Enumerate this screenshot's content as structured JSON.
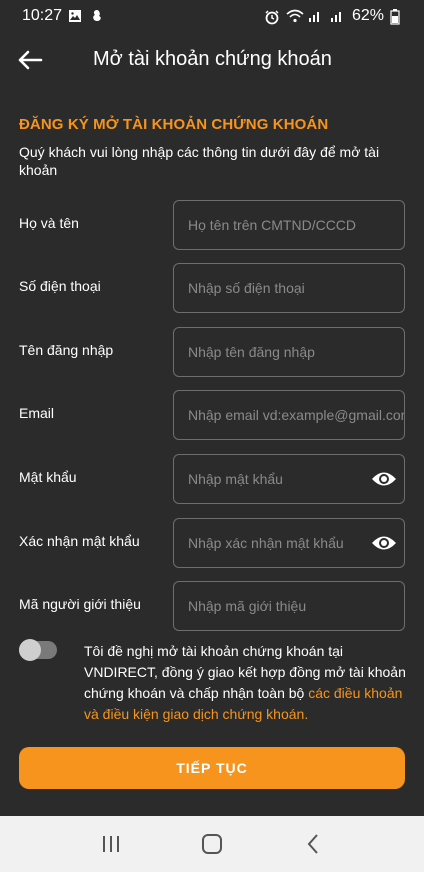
{
  "status_bar": {
    "time": "10:27",
    "battery": "62%",
    "left_icons": [
      "gallery-icon",
      "notification-icon"
    ],
    "right_icons": [
      "alarm-icon",
      "wifi-icon",
      "signal-icon",
      "signal-icon",
      "battery-icon"
    ]
  },
  "app_bar": {
    "title": "Mở tài khoản chứng khoán",
    "back_icon": "arrow-left-icon"
  },
  "section": {
    "title": "ĐĂNG KÝ MỞ TÀI KHOẢN CHỨNG KHOÁN",
    "description": "Quý khách vui lòng nhập các thông tin dưới đây để mở tài khoản"
  },
  "form": {
    "fields": [
      {
        "label": "Họ và tên",
        "placeholder": "Họ tên trên CMTND/CCCD",
        "value": ""
      },
      {
        "label": "Số điện thoại",
        "placeholder": "Nhập số điện thoại",
        "value": ""
      },
      {
        "label": "Tên đăng nhập",
        "placeholder": "Nhập tên đăng nhập",
        "value": ""
      },
      {
        "label": "Email",
        "placeholder": "Nhập email vd:example@gmail.com",
        "value": ""
      },
      {
        "label": "Mật khẩu",
        "placeholder": "Nhập mật khẩu",
        "value": "",
        "icon": "eye-icon"
      },
      {
        "label": "Xác nhận mật khẩu",
        "placeholder": "Nhập xác nhận mật khẩu",
        "value": "",
        "icon": "eye-icon"
      },
      {
        "label": "Mã người giới thiệu",
        "placeholder": "Nhập mã giới thiệu",
        "value": ""
      }
    ]
  },
  "consent": {
    "toggle_on": false,
    "text": "Tôi đề nghị mở tài khoản chứng khoán tại VNDIRECT, đồng ý giao kết hợp đồng mở tài khoản chứng khoán và chấp nhận toàn bộ ",
    "link_text": "các điều khoản và điều kiện giao dịch chứng khoán",
    "end_text": "."
  },
  "continue_button": {
    "label": "TIẾP TỤC"
  },
  "nav_bar": {
    "icons": [
      "recent-apps-icon",
      "home-icon",
      "back-icon"
    ]
  },
  "colors": {
    "background": "#2b2b2b",
    "accent": "#f7941d",
    "field_border": "#6e6e6e",
    "nav_background": "#f1f1f1"
  }
}
